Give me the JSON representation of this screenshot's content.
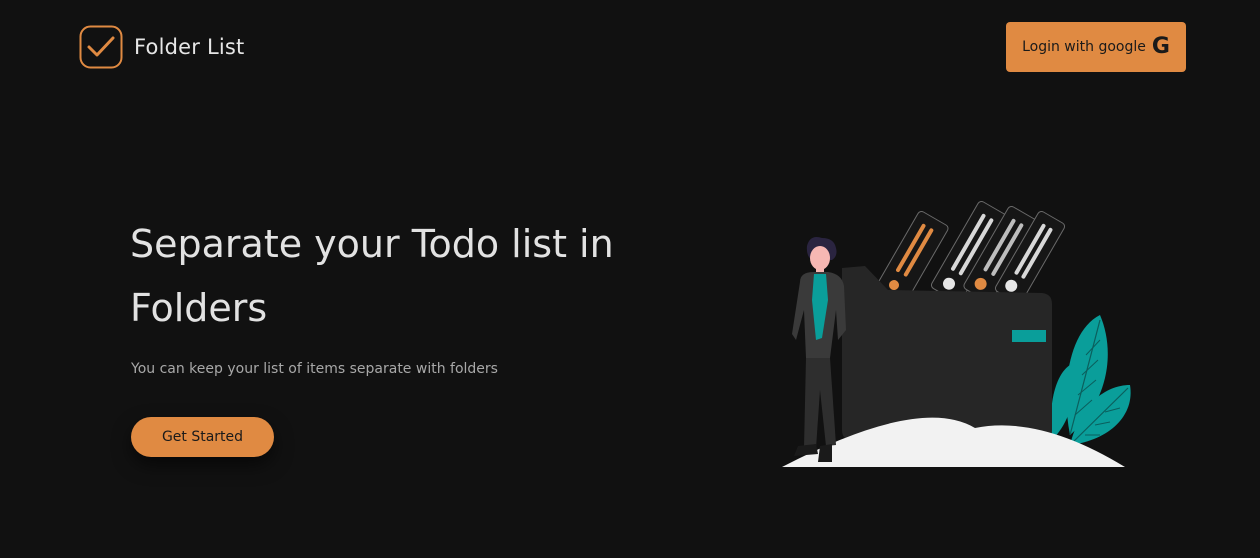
{
  "brand": {
    "title": "Folder List",
    "icon": "checkbox-check-icon"
  },
  "navbar": {
    "login_label": "Login with google",
    "login_icon": "google-g-icon",
    "login_icon_glyph": "G"
  },
  "hero": {
    "title": "Separate your Todo list in Folders",
    "subtitle": "You can keep your list of items separate with folders",
    "cta_label": "Get Started"
  },
  "illustration": {
    "name": "person-with-folders-illustration"
  },
  "colors": {
    "background": "#111111",
    "accent": "#e08a42",
    "teal": "#0a9e9a",
    "text": "#e2e2e2",
    "muted": "#a8a8a8"
  }
}
